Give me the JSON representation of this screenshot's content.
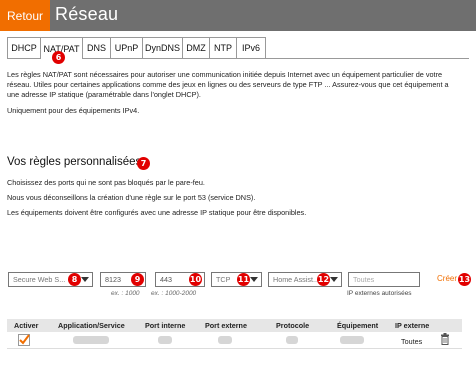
{
  "header": {
    "back_label": "Retour",
    "title": "Réseau"
  },
  "tabs": [
    {
      "label": "DHCP",
      "active": false
    },
    {
      "label": "NAT/PAT",
      "active": true
    },
    {
      "label": "DNS",
      "active": false
    },
    {
      "label": "UPnP",
      "active": false
    },
    {
      "label": "DynDNS",
      "active": false
    },
    {
      "label": "DMZ",
      "active": false
    },
    {
      "label": "NTP",
      "active": false
    },
    {
      "label": "IPv6",
      "active": false
    }
  ],
  "intro": {
    "line1": "Les règles NAT/PAT sont nécessaires pour autoriser une communication initiée depuis Internet avec un équipement particulier de votre",
    "line2": "réseau. Utiles pour certaines applications comme des jeux en lignes ou des serveurs de type FTP ... Assurez-vous que cet équipement a",
    "line3": "une adresse IP statique (paramétrable dans l'onglet DHCP).",
    "line4": "Uniquement pour des équipements IPv4."
  },
  "rules": {
    "title": "Vos règles personnalisées",
    "note1": "Choisissez des ports qui ne sont pas bloqués par le pare-feu.",
    "note2": "Nous vous déconseillons la création d'une règle sur le port 53 (service DNS).",
    "note3": "Les équipements doivent être configurés avec une adresse IP statique pour être disponibles."
  },
  "form": {
    "service_value": "Secure Web S...",
    "internal_port_value": "8123",
    "internal_port_hint": "ex. : 1000",
    "external_port_value": "443",
    "external_port_hint": "ex. : 1000-2000",
    "protocol_value": "TCP",
    "device_value": "Home Assist...",
    "external_ip_placeholder": "Toutes",
    "external_ip_hint": "IP externes autorisées",
    "create_label": "Créer"
  },
  "badges": [
    "6",
    "7",
    "8",
    "9",
    "10",
    "11",
    "12",
    "13"
  ],
  "table": {
    "headers": [
      "Activer",
      "Application/Service",
      "Port interne",
      "Port externe",
      "Protocole",
      "Équipement",
      "IP externe"
    ],
    "row": {
      "ip_externe": "Toutes",
      "activated": true
    }
  },
  "colors": {
    "accent": "#f16e00",
    "badge": "#e10000",
    "header_bg": "#6f6f6f"
  },
  "icons": {
    "delete": "trash-icon",
    "checkbox": "checkbox-checked-icon",
    "dropdown": "chevron-down-icon"
  }
}
